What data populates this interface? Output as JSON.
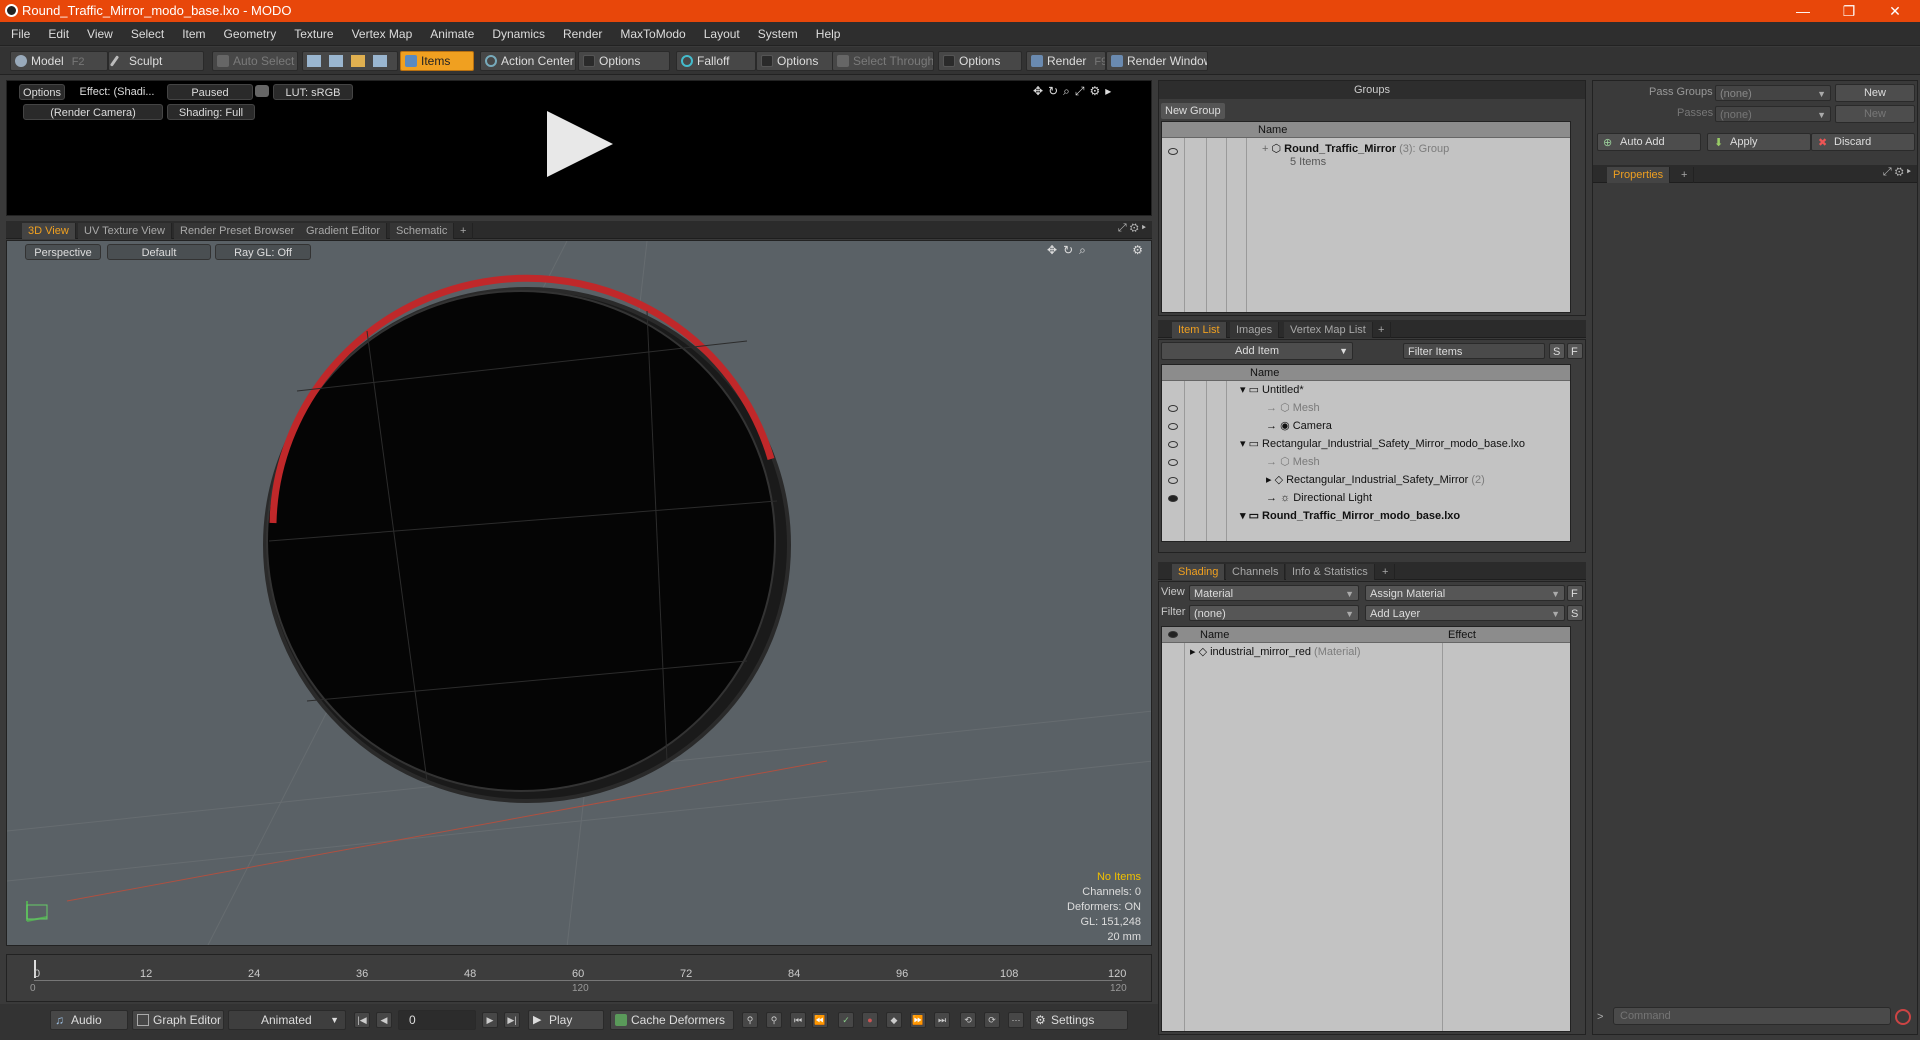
{
  "window": {
    "title": "Round_Traffic_Mirror_modo_base.lxo - MODO",
    "minimize": "—",
    "restore": "❐",
    "close": "✕"
  },
  "menu": [
    "File",
    "Edit",
    "View",
    "Select",
    "Item",
    "Geometry",
    "Texture",
    "Vertex Map",
    "Animate",
    "Dynamics",
    "Render",
    "MaxToModo",
    "Layout",
    "System",
    "Help"
  ],
  "toolbar": {
    "model": "Model",
    "model_key": "F2",
    "sculpt": "Sculpt",
    "auto_select": "Auto Select",
    "items": "Items",
    "action_center": "Action Center",
    "options1": "Options",
    "falloff": "Falloff",
    "options2": "Options",
    "select_through": "Select Through",
    "options3": "Options",
    "render": "Render",
    "render_key": "F9",
    "render_window": "Render Window"
  },
  "preview": {
    "options": "Options",
    "effect": "Effect: (Shadi...",
    "paused": "Paused",
    "lut": "LUT: sRGB",
    "camera": "(Render Camera)",
    "shading": "Shading: Full"
  },
  "viewport_tabs": [
    "3D View",
    "UV Texture View",
    "Render Preset Browser",
    "Gradient Editor",
    "Schematic",
    "+"
  ],
  "viewport": {
    "perspective": "Perspective",
    "default": "Default",
    "raygl": "Ray GL: Off",
    "hud": {
      "no_items": "No Items",
      "channels": "Channels: 0",
      "deformers": "Deformers: ON",
      "gl": "GL: 151,248",
      "mm": "20 mm"
    }
  },
  "timeline": {
    "ticks": [
      "0",
      "12",
      "24",
      "36",
      "48",
      "60",
      "72",
      "84",
      "96",
      "108",
      "120"
    ],
    "sub_start": "0",
    "sub_mid": "120",
    "sub_end": "120"
  },
  "transport": {
    "audio": "Audio",
    "graph_editor": "Graph Editor",
    "animated": "Animated",
    "frame": "0",
    "play": "Play",
    "cache_deformers": "Cache Deformers",
    "settings": "Settings"
  },
  "groups": {
    "title": "Groups",
    "new_group": "New Group",
    "col_name": "Name",
    "row_name": "Round_Traffic_Mirror",
    "row_count": "(3)",
    "row_type": ": Group",
    "row_sub": "5 Items"
  },
  "passes": {
    "pass_groups_label": "Pass Groups",
    "pass_groups_value": "(none)",
    "new1": "New",
    "passes_label": "Passes",
    "passes_value": "(none)",
    "new2": "New"
  },
  "actions": {
    "auto_add": "Auto Add",
    "apply": "Apply",
    "discard": "Discard"
  },
  "properties": {
    "tab": "Properties",
    "plus": "+"
  },
  "item_list": {
    "tabs": [
      "Item List",
      "Images",
      "Vertex Map List",
      "+"
    ],
    "add_item": "Add Item",
    "filter_items": "Filter Items",
    "s": "S",
    "f": "F",
    "col_name": "Name",
    "rows": [
      {
        "label": "Untitled*",
        "extra": ""
      },
      {
        "label": "Mesh",
        "extra": ""
      },
      {
        "label": "Camera",
        "extra": ""
      },
      {
        "label": "Rectangular_Industrial_Safety_Mirror_modo_base.lxo",
        "extra": ""
      },
      {
        "label": "Mesh",
        "extra": ""
      },
      {
        "label": "Rectangular_Industrial_Safety_Mirror",
        "extra": "(2)"
      },
      {
        "label": "Directional Light",
        "extra": ""
      },
      {
        "label": "Round_Traffic_Mirror_modo_base.lxo",
        "extra": ""
      }
    ]
  },
  "shading": {
    "tabs": [
      "Shading",
      "Channels",
      "Info & Statistics",
      "+"
    ],
    "view_label": "View",
    "view_value": "Material",
    "assign_material": "Assign Material",
    "f": "F",
    "filter_label": "Filter",
    "filter_value": "(none)",
    "add_layer": "Add Layer",
    "s": "S",
    "col_name": "Name",
    "col_effect": "Effect",
    "row_name": "industrial_mirror_red",
    "row_type": "(Material)"
  },
  "command": {
    "placeholder": "Command"
  },
  "colors": {
    "titlebar": "#e8470a",
    "accent": "#f0a020",
    "mirror_rim": "#c0282a"
  }
}
